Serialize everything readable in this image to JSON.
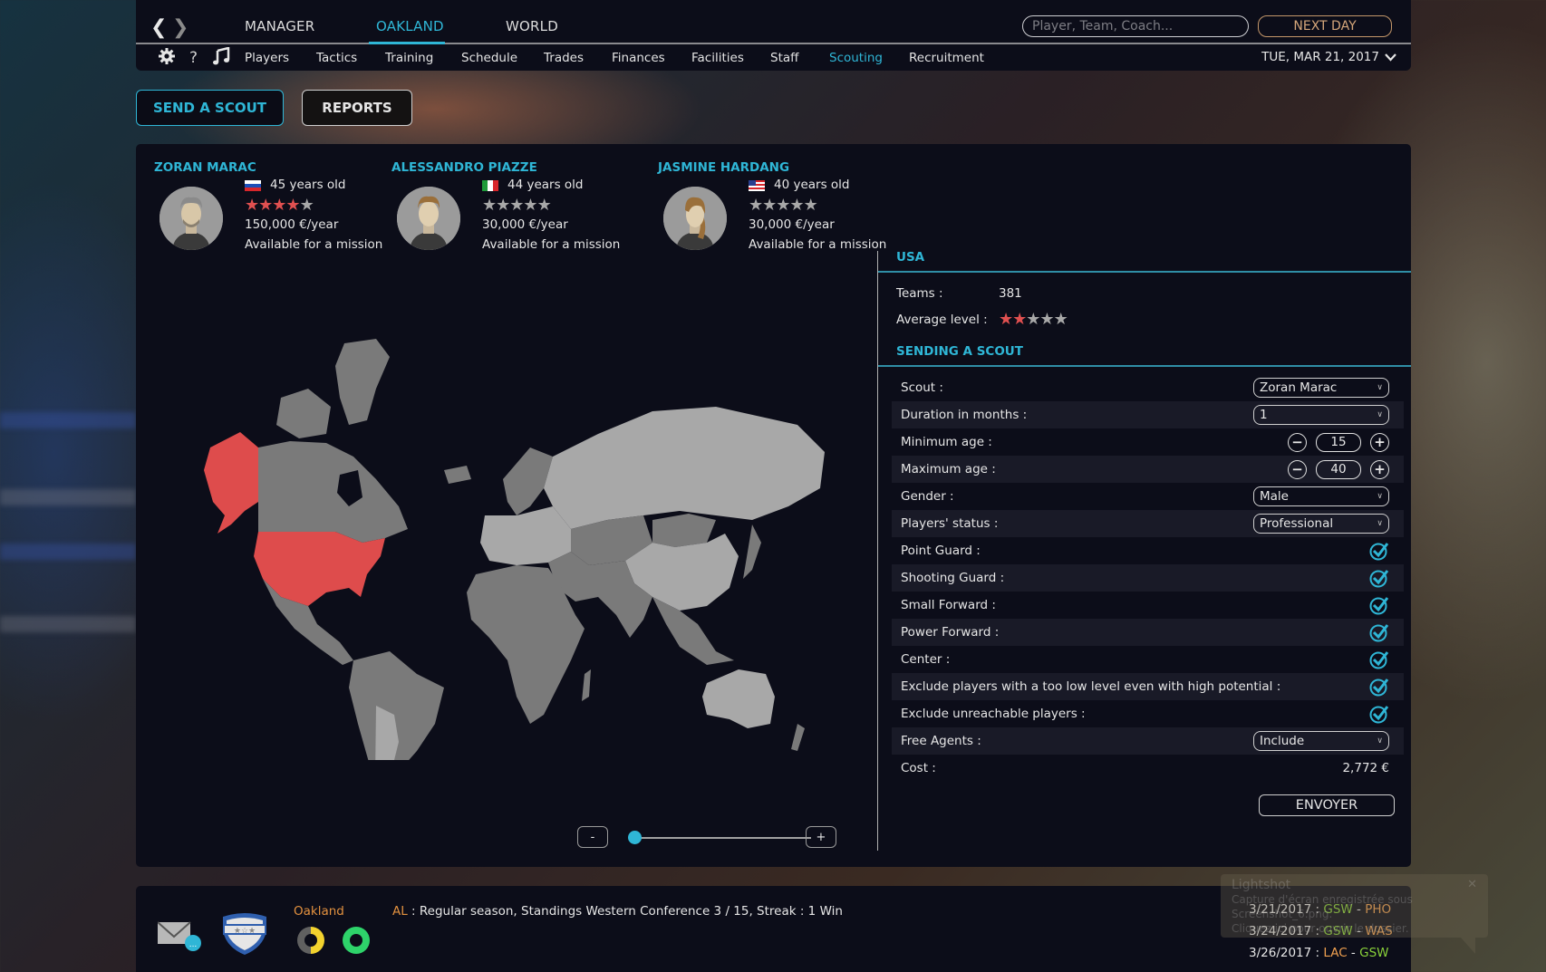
{
  "nav": {
    "back_icon": "chevron-left-icon",
    "forward_icon": "chevron-right-icon",
    "main_tabs": [
      {
        "label": "MANAGER",
        "active": false
      },
      {
        "label": "OAKLAND",
        "active": true
      },
      {
        "label": "WORLD",
        "active": false
      }
    ],
    "search_placeholder": "Player, Team, Coach...",
    "next_day_label": "NEXT DAY",
    "sub_icons": [
      "gear-icon",
      "help-icon",
      "music-icon"
    ],
    "help_glyph": "?",
    "sub_tabs": [
      {
        "label": "Players",
        "active": false
      },
      {
        "label": "Tactics",
        "active": false
      },
      {
        "label": "Training",
        "active": false
      },
      {
        "label": "Schedule",
        "active": false
      },
      {
        "label": "Trades",
        "active": false
      },
      {
        "label": "Finances",
        "active": false
      },
      {
        "label": "Facilities",
        "active": false
      },
      {
        "label": "Staff",
        "active": false
      },
      {
        "label": "Scouting",
        "active": true
      },
      {
        "label": "Recruitment",
        "active": false
      }
    ],
    "date": "TUE, MAR 21, 2017"
  },
  "actions": {
    "send_scout": "SEND A SCOUT",
    "reports": "REPORTS"
  },
  "scouts": [
    {
      "name": "ZORAN MARAC",
      "country": "Slovenia",
      "age": "45 years old",
      "rating": 4,
      "max_rating": 5,
      "salary": "150,000 €/year",
      "status": "Available for a mission"
    },
    {
      "name": "ALESSANDRO PIAZZE",
      "country": "Italy",
      "age": "44 years old",
      "rating": 0,
      "max_rating": 5,
      "salary": "30,000 €/year",
      "status": "Available for a mission"
    },
    {
      "name": "JASMINE HARDANG",
      "country": "USA",
      "age": "40 years old",
      "rating": 0,
      "max_rating": 5,
      "salary": "30,000 €/year",
      "status": "Available for a mission"
    }
  ],
  "map": {
    "selected_country": "USA",
    "zoom_out_label": "-",
    "zoom_in_label": "+",
    "zoom_level": 0,
    "colors": {
      "selected": "#de4c4c",
      "region_dark": "#7a7a7a",
      "region_light": "#a8a8a8"
    }
  },
  "country_info": {
    "title": "USA",
    "teams_label": "Teams :",
    "teams_value": "381",
    "avg_level_label": "Average level :",
    "avg_level": 2,
    "avg_level_max": 5
  },
  "sending": {
    "title": "SENDING A SCOUT",
    "scout_label": "Scout :",
    "scout_value": "Zoran Marac",
    "duration_label": "Duration in months :",
    "duration_value": "1",
    "min_age_label": "Minimum age :",
    "min_age_value": "15",
    "max_age_label": "Maximum age :",
    "max_age_value": "40",
    "gender_label": "Gender :",
    "gender_value": "Male",
    "status_label": "Players' status :",
    "status_value": "Professional",
    "checks": [
      {
        "label": "Point Guard :",
        "checked": true
      },
      {
        "label": "Shooting Guard :",
        "checked": true
      },
      {
        "label": "Small Forward :",
        "checked": true
      },
      {
        "label": "Power Forward :",
        "checked": true
      },
      {
        "label": "Center :",
        "checked": true
      },
      {
        "label": "Exclude players with a too low level even with high potential :",
        "checked": true
      },
      {
        "label": "Exclude unreachable players :",
        "checked": true
      }
    ],
    "free_agents_label": "Free Agents :",
    "free_agents_value": "Include",
    "cost_label": "Cost :",
    "cost_value": "2,772 €",
    "submit_label": "ENVOYER"
  },
  "footer": {
    "mail_icon": "mail-icon",
    "badge_icon": "team-shield-icon",
    "team_name": "Oakland",
    "league": "AL",
    "status": " : Regular season, Standings Western Conference 3 / 15, Streak : 1 Win",
    "schedule": [
      {
        "date": "3/21/2017",
        "home": "GSW",
        "away": "PHO",
        "home_color": "green"
      },
      {
        "date": "3/24/2017",
        "home": "GSW",
        "away": "WAS",
        "home_color": "green"
      },
      {
        "date": "3/26/2017",
        "home": "LAC",
        "away": "GSW",
        "home_color": "orange"
      }
    ]
  },
  "notification": {
    "title": "Lightshot",
    "line1": "Capture d'écran enregistrée sous Screenshot_6.png.",
    "line2": "Cliquez ici pour ouvrir le dossier."
  }
}
